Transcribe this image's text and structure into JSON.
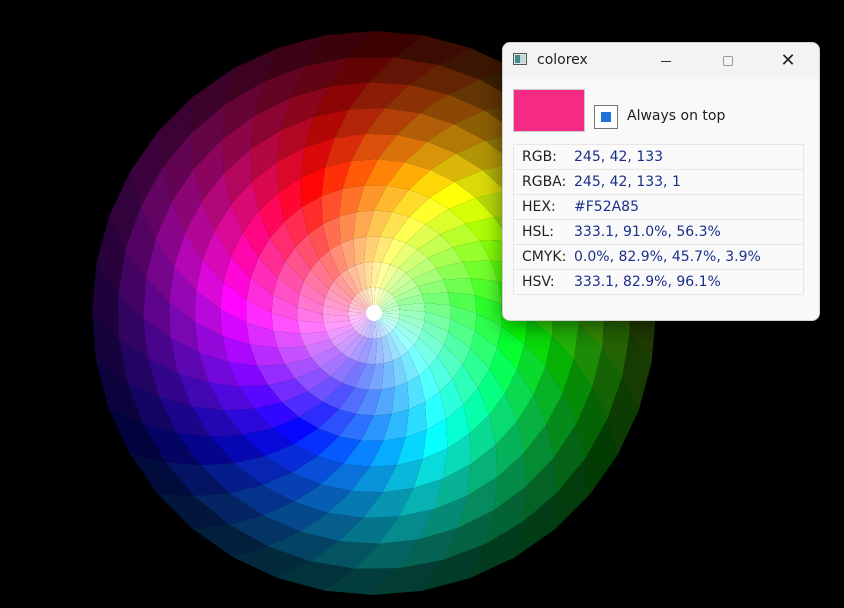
{
  "window": {
    "title": "colorex",
    "swatch_color": "#F52A85",
    "always_on_top": {
      "label": "Always on top",
      "checked": true
    },
    "values": [
      {
        "key": "RGB:",
        "value": "245, 42, 133"
      },
      {
        "key": "RGBA:",
        "value": "245, 42, 133, 1"
      },
      {
        "key": "HEX:",
        "value": "#F52A85"
      },
      {
        "key": "HSL:",
        "value": "333.1, 91.0%, 56.3%"
      },
      {
        "key": "CMYK:",
        "value": "0.0%, 82.9%, 45.7%, 3.9%"
      },
      {
        "key": "HSV:",
        "value": "333.1, 82.9%, 96.1%"
      }
    ]
  },
  "colors": {
    "background": "#000000",
    "value_text": "#1b2f8a",
    "checkbox_accent": "#1e74d8"
  }
}
